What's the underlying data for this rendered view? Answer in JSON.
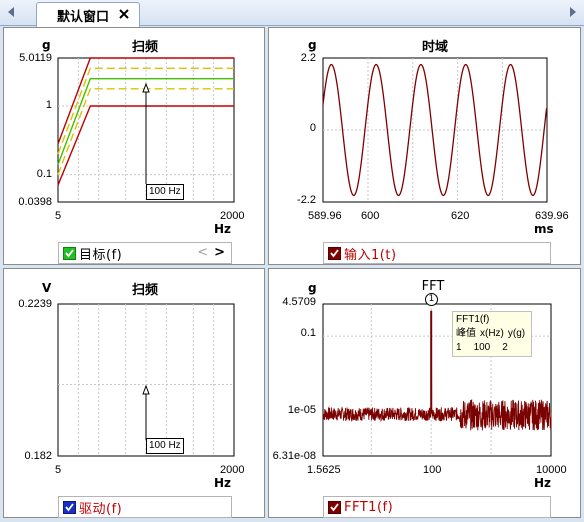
{
  "tab": {
    "label": "默认窗口",
    "close": "×",
    "left_arrow": "◄",
    "right_arrow": "►"
  },
  "colors": {
    "sweep_limit": "#c00000",
    "sweep_abort": "#e0c000",
    "sweep_target": "#44c000",
    "time": "#800000",
    "fft": "#7b0000"
  },
  "panels": {
    "sweep_top": {
      "title": "扫频",
      "y_unit": "g",
      "x_unit": "Hz",
      "y_ticks": [
        "5.0119",
        "1",
        "0.1",
        "0.0398"
      ],
      "x_ticks": [
        "5",
        "2000"
      ],
      "cursor_label": "100 Hz",
      "legend": "目标(f)"
    },
    "time_domain": {
      "title": "时域",
      "y_unit": "g",
      "x_unit": "ms",
      "y_ticks": [
        "2.2",
        "0",
        "-2.2"
      ],
      "x_ticks": [
        "589.96",
        "600",
        "620",
        "639.96"
      ],
      "legend": "输入1(t)"
    },
    "sweep_drive": {
      "title": "扫频",
      "y_unit": "V",
      "x_unit": "Hz",
      "y_ticks": [
        "0.2239",
        "0.182"
      ],
      "x_ticks": [
        "5",
        "2000"
      ],
      "cursor_label": "100 Hz",
      "legend": "驱动(f)"
    },
    "fft": {
      "title": "FFT",
      "y_unit": "g",
      "x_unit": "Hz",
      "y_ticks": [
        "4.5709",
        "0.1",
        "1e-05",
        "6.31e-08"
      ],
      "x_ticks": [
        "1.5625",
        "100",
        "10000"
      ],
      "marker": "1",
      "info": {
        "name": "FFT1(f)",
        "col_label": "峰值",
        "col_x": "x(Hz)",
        "col_y": "y(g)",
        "row_idx": "1",
        "row_x": "100",
        "row_y": "2"
      },
      "legend": "FFT1(f)"
    }
  },
  "chart_data": [
    {
      "type": "line",
      "title": "扫频",
      "xlabel": "Hz",
      "ylabel": "g",
      "xlim": [
        5,
        2000
      ],
      "ylim": [
        0.0398,
        5.0119
      ],
      "xscale": "log",
      "yscale": "log",
      "series": [
        {
          "x": [
            5,
            15,
            2000
          ],
          "values": [
            0.28,
            5.0119,
            5.0119
          ],
          "style": "limit"
        },
        {
          "x": [
            5,
            15,
            2000
          ],
          "values": [
            0.2,
            3.55,
            3.55
          ],
          "style": "abort-dashed"
        },
        {
          "x": [
            5,
            15,
            2000
          ],
          "values": [
            0.14,
            2.5,
            2.5
          ],
          "style": "target"
        },
        {
          "x": [
            5,
            15,
            2000
          ],
          "values": [
            0.1,
            1.78,
            1.78
          ],
          "style": "abort-dashed"
        },
        {
          "x": [
            5,
            15,
            2000
          ],
          "values": [
            0.07,
            1,
            1
          ],
          "style": "limit"
        }
      ],
      "cursor_x": 100
    },
    {
      "type": "line",
      "title": "时域",
      "xlabel": "ms",
      "ylabel": "g",
      "xlim": [
        589.96,
        639.96
      ],
      "ylim": [
        -2.2,
        2.2
      ],
      "series": [
        {
          "name": "输入1(t)",
          "amplitude": 2.0,
          "frequency_hz": 100
        }
      ]
    },
    {
      "type": "line",
      "title": "扫频",
      "xlabel": "Hz",
      "ylabel": "V",
      "xlim": [
        5,
        2000
      ],
      "ylim": [
        0.182,
        0.2239
      ],
      "xscale": "log",
      "series": [],
      "cursor_x": 100
    },
    {
      "type": "line",
      "title": "FFT",
      "xlabel": "Hz",
      "ylabel": "g",
      "xlim": [
        1.5625,
        10000
      ],
      "ylim": [
        6.31e-08,
        4.5709
      ],
      "xscale": "log",
      "yscale": "log",
      "series": [
        {
          "name": "FFT1(f)",
          "peak_x": 100,
          "peak_y": 2,
          "noise_floor": 1e-05
        }
      ]
    }
  ]
}
